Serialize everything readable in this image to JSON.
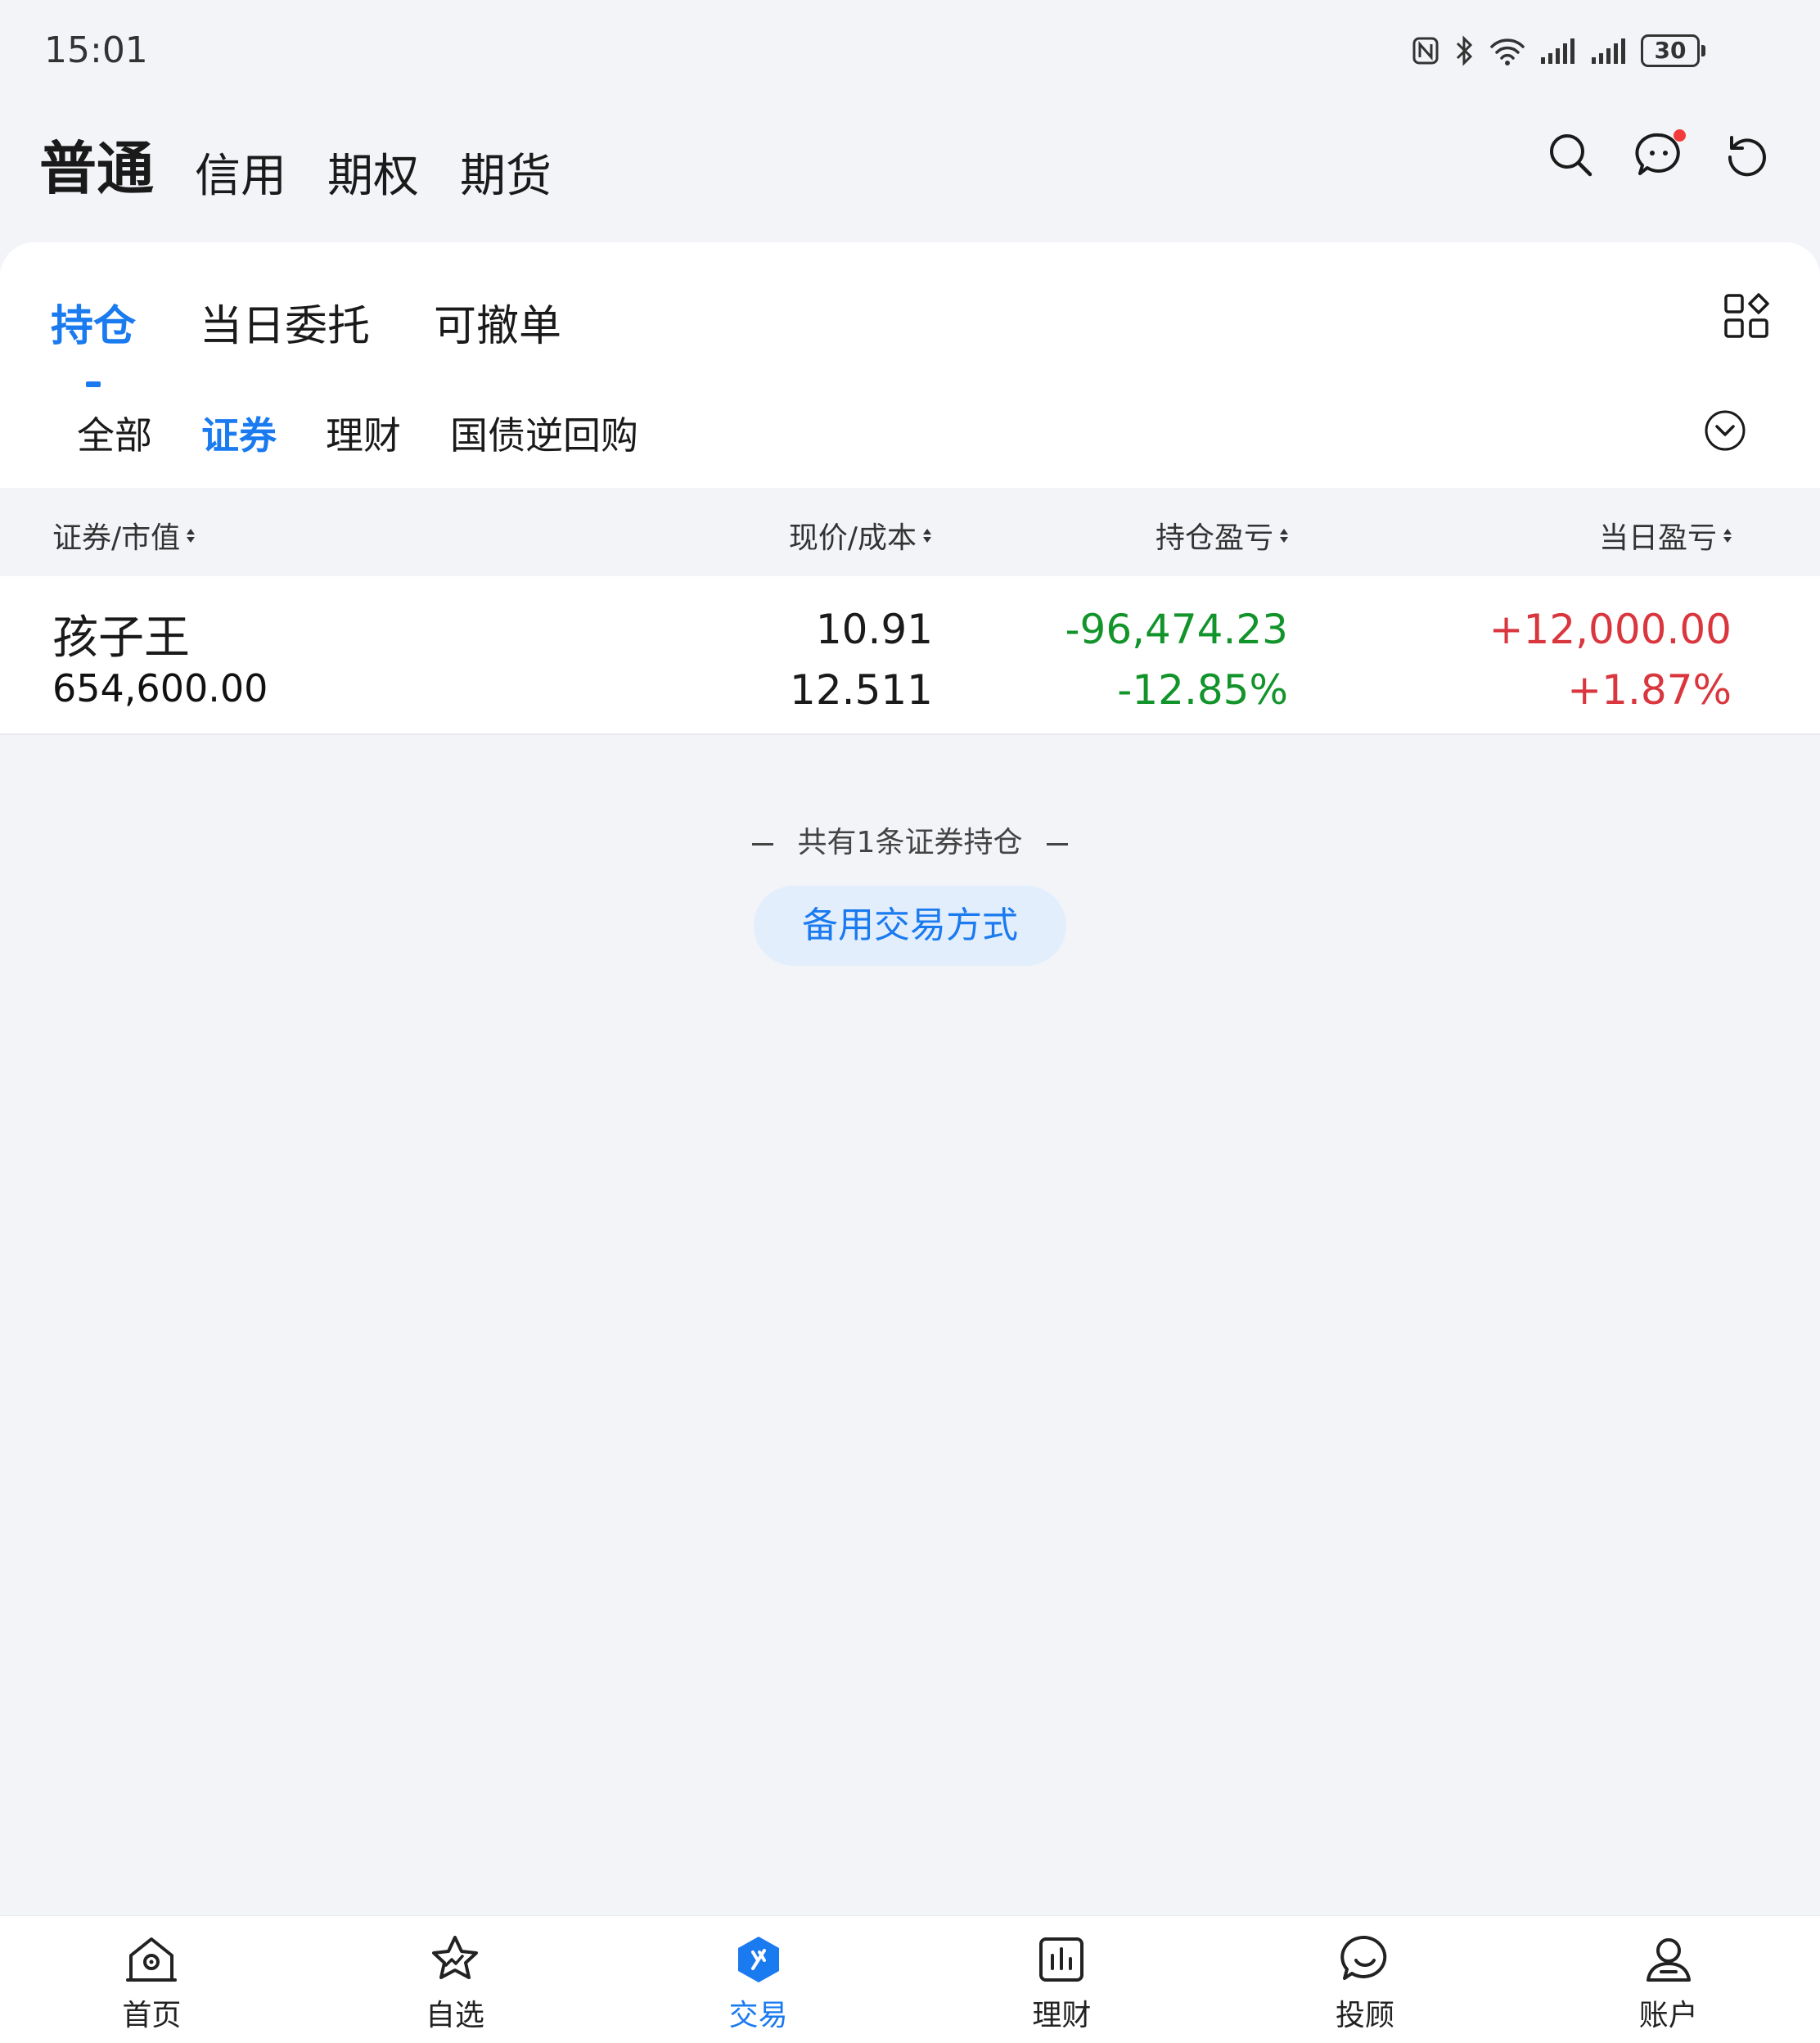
{
  "status_bar": {
    "time": "15:01",
    "battery": "30"
  },
  "account_tabs": [
    {
      "label": "普通",
      "active": true
    },
    {
      "label": "信用",
      "active": false
    },
    {
      "label": "期权",
      "active": false
    },
    {
      "label": "期货",
      "active": false
    }
  ],
  "main_tabs": [
    {
      "label": "持仓",
      "active": true
    },
    {
      "label": "当日委托",
      "active": false
    },
    {
      "label": "可撤单",
      "active": false
    }
  ],
  "sub_tabs": [
    {
      "label": "全部",
      "active": false
    },
    {
      "label": "证券",
      "active": true
    },
    {
      "label": "理财",
      "active": false
    },
    {
      "label": "国债逆回购",
      "active": false
    }
  ],
  "table": {
    "headers": [
      "证券/市值",
      "现价/成本",
      "持仓盈亏",
      "当日盈亏"
    ],
    "rows": [
      {
        "name": "孩子王",
        "market_value": "654,600.00",
        "price": "10.91",
        "cost": "12.511",
        "hold_pl": "-96,474.23",
        "hold_pl_pct": "-12.85%",
        "day_pl": "+12,000.00",
        "day_pl_pct": "+1.87%"
      }
    ]
  },
  "summary": "共有1条证券持仓",
  "alt_trade_button": "备用交易方式",
  "bottom_nav": [
    {
      "label": "首页",
      "icon": "home-icon",
      "active": false
    },
    {
      "label": "自选",
      "icon": "star-icon",
      "active": false
    },
    {
      "label": "交易",
      "icon": "trade-icon",
      "active": true
    },
    {
      "label": "理财",
      "icon": "finance-icon",
      "active": false
    },
    {
      "label": "投顾",
      "icon": "advisor-icon",
      "active": false
    },
    {
      "label": "账户",
      "icon": "account-icon",
      "active": false
    }
  ],
  "colors": {
    "accent": "#1a7af0",
    "loss": "#12942b",
    "gain": "#d9363e"
  }
}
